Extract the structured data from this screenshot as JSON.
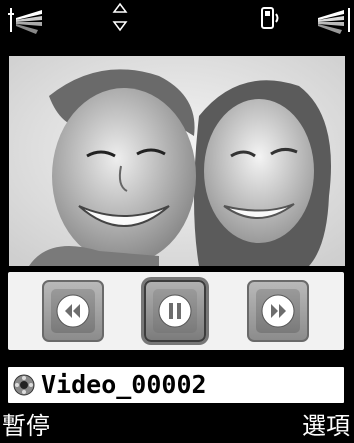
{
  "status_bar": {
    "signal_icon": "signal-strength-icon",
    "scroll_icon": "scroll-up-down-icon",
    "phone_icon": "phone-profile-icon",
    "battery_icon": "battery-level-icon"
  },
  "player": {
    "buttons": [
      {
        "icon": "rewind-icon"
      },
      {
        "icon": "pause-icon"
      },
      {
        "icon": "fast-forward-icon"
      }
    ],
    "file_icon": "video-file-icon",
    "file_name": "Video_00002"
  },
  "softkeys": {
    "left": "暫停",
    "right": "選項"
  },
  "colors": {
    "background": "#000000",
    "control_panel": "#f2f2f2",
    "button_gray": "#9a9a9a",
    "text_light": "#ffffff"
  }
}
